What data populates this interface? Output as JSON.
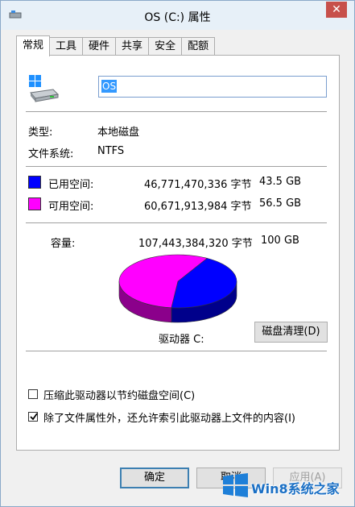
{
  "window": {
    "title": "OS (C:) 属性",
    "close": "✕"
  },
  "tabs": [
    "常规",
    "工具",
    "硬件",
    "共享",
    "安全",
    "配额"
  ],
  "drive": {
    "name": "OS"
  },
  "info": {
    "type_label": "类型:",
    "type_value": "本地磁盘",
    "fs_label": "文件系统:",
    "fs_value": "NTFS"
  },
  "space": {
    "used_label": "已用空间:",
    "used_bytes": "46,771,470,336 字节",
    "used_size": "43.5 GB",
    "free_label": "可用空间:",
    "free_bytes": "60,671,913,984 字节",
    "free_size": "56.5 GB",
    "capacity_label": "容量:",
    "capacity_bytes": "107,443,384,320 字节",
    "capacity_size": "100 GB",
    "used_color": "#0000ff",
    "free_color": "#ff00ff"
  },
  "chart_data": {
    "type": "pie",
    "categories": [
      "已用空间",
      "可用空间"
    ],
    "values": [
      43.5,
      56.5
    ]
  },
  "drive_label": "驱动器 C:",
  "cleanup_button": "磁盘清理(D)",
  "options": {
    "compress": {
      "label": "压缩此驱动器以节约磁盘空间(C)",
      "checked": false
    },
    "index": {
      "label": "除了文件属性外，还允许索引此驱动器上文件的内容(I)",
      "checked": true
    }
  },
  "buttons": {
    "ok": "确定",
    "cancel": "取消",
    "apply": "应用(A)"
  },
  "watermark": {
    "text": "Win8系统之家"
  }
}
